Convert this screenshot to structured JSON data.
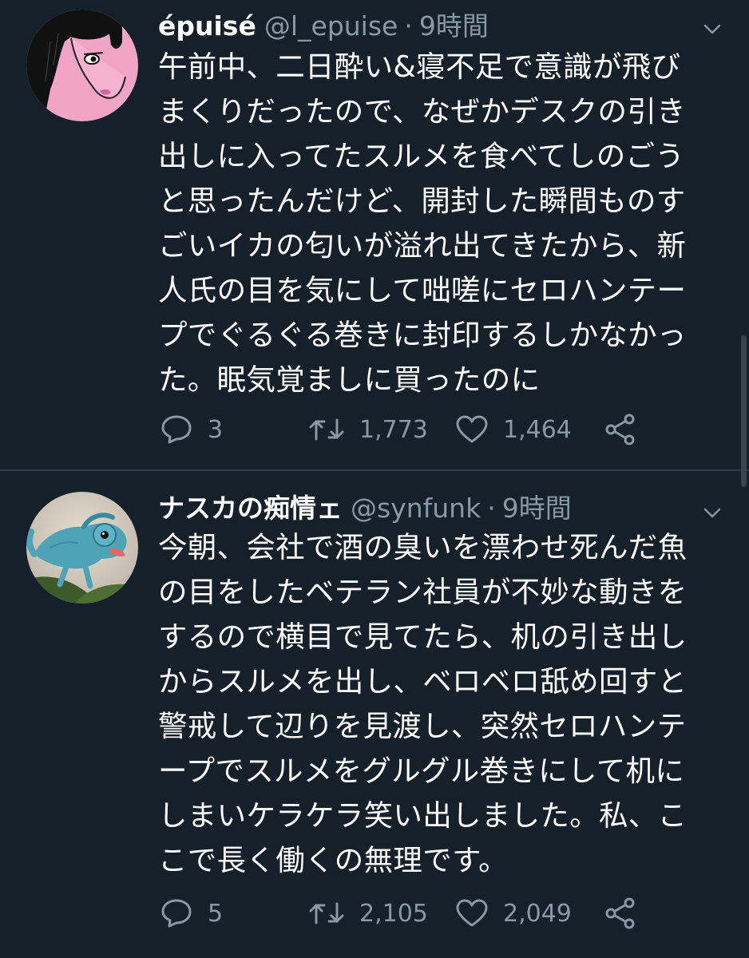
{
  "tweets": [
    {
      "display_name": "épuisé",
      "handle": "@l_epuise",
      "separator": "·",
      "time": "9時間",
      "text": "午前中、二日酔い&寝不足で意識が飛び\nまくりだったので、なぜかデスクの引き\n出しに入ってたスルメを食べてしのごう\nと思ったんだけど、開封した瞬間ものす\nごいイカの匂いが溢れ出てきたから、新\n人氏の目を気にして咄嗟にセロハンテー\nプでぐるぐる巻きに封印するしかなかっ\nた。眠気覚ましに買ったのに",
      "replies": "3",
      "retweets": "1,773",
      "likes": "1,464"
    },
    {
      "display_name": "ナスカの痴情ェ",
      "handle": "@synfunk",
      "separator": "·",
      "time": "9時間",
      "text": "今朝、会社で酒の臭いを漂わせ死んだ魚\nの目をしたベテラン社員が不妙な動きを\nするので横目で見てたら、机の引き出し\nからスルメを出し、ベロベロ舐め回すと\n警戒して辺りを見渡し、突然セロハンテ\nープでスルメをグルグル巻きにして机に\nしまいケラケラ笑い出しました。私、こ\nこで長く働くの無理です。",
      "replies": "5",
      "retweets": "2,105",
      "likes": "2,049"
    }
  ],
  "colors": {
    "background": "#15202b",
    "text": "#ffffff",
    "secondary": "#8899a6",
    "divider": "#2f3d4a"
  },
  "icons": [
    "chevron-down-icon",
    "reply-icon",
    "retweet-icon",
    "like-icon",
    "share-icon"
  ]
}
